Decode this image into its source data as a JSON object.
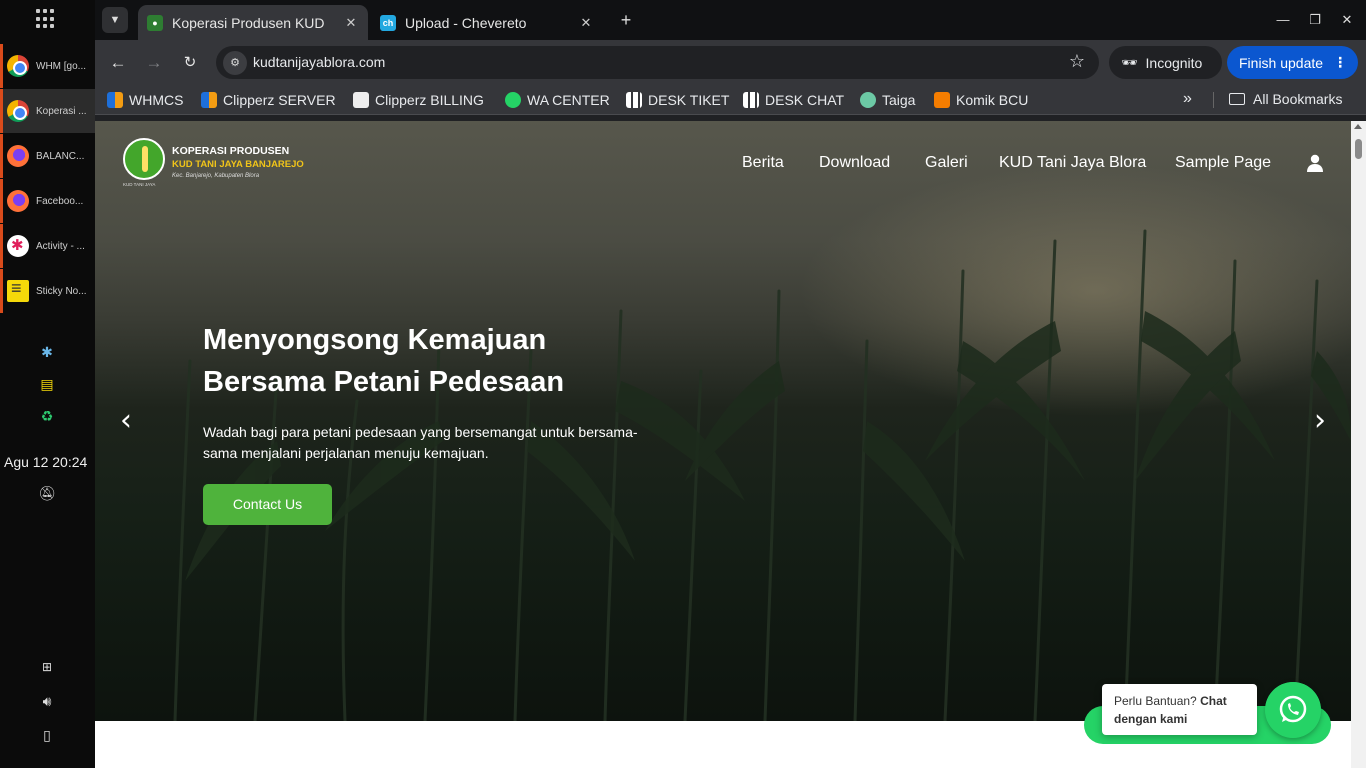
{
  "taskbar": {
    "items": [
      {
        "label": "WHM [go...",
        "icon": "chrome-icon"
      },
      {
        "label": "Koperasi ...",
        "icon": "chrome-icon"
      },
      {
        "label": "BALANC...",
        "icon": "firefox-icon"
      },
      {
        "label": "Faceboo...",
        "icon": "firefox-icon"
      },
      {
        "label": "Activity - ...",
        "icon": "slack-icon"
      },
      {
        "label": "Sticky No...",
        "icon": "sticky-notes-icon"
      }
    ],
    "clock": "Agu 12  20:24"
  },
  "browser": {
    "tabs": [
      {
        "title": "Koperasi Produsen KUD",
        "favicon": "kud-favicon",
        "active": true
      },
      {
        "title": "Upload - Chevereto",
        "favicon": "chevereto-favicon",
        "active": false
      }
    ],
    "url": "kudtanijayablora.com",
    "incognito_label": "Incognito",
    "finish_update_label": "Finish update",
    "bookmarks": [
      {
        "label": "WHMCS",
        "icon": "whmcs-icon"
      },
      {
        "label": "Clipperz SERVER",
        "icon": "clipperz-icon"
      },
      {
        "label": "Clipperz BILLING",
        "icon": "clipperz-billing-icon"
      },
      {
        "label": "WA CENTER",
        "icon": "whatsapp-icon"
      },
      {
        "label": "DESK TIKET",
        "icon": "desk-icon"
      },
      {
        "label": "DESK CHAT",
        "icon": "desk-icon"
      },
      {
        "label": "Taiga",
        "icon": "taiga-icon"
      },
      {
        "label": "Komik BCU",
        "icon": "blogger-icon"
      }
    ],
    "all_bookmarks_label": "All Bookmarks"
  },
  "site": {
    "logo": {
      "line1": "KOPERASI PRODUSEN",
      "line2": "KUD TANI JAYA BANJAREJO",
      "line3": "Kec. Banjarejo, Kabupaten Blora",
      "line4": "KUD TANI JAYA"
    },
    "menu": [
      "Berita",
      "Download",
      "Galeri",
      "KUD Tani Jaya Blora",
      "Sample Page"
    ],
    "hero": {
      "title_line1": "Menyongsong Kemajuan",
      "title_line2": "Bersama Petani Pedesaan",
      "subtitle": "Wadah bagi para petani pedesaan yang bersemangat untuk bersama-sama menjalani perjalanan menuju kemajuan.",
      "cta_label": "Contact Us"
    },
    "chat": {
      "prompt": "Perlu Bantuan?",
      "cta": "Chat dengan kami"
    }
  },
  "colors": {
    "accent_green": "#4fb33c",
    "whatsapp_green": "#25d366",
    "chrome_blue": "#0b57d0"
  }
}
